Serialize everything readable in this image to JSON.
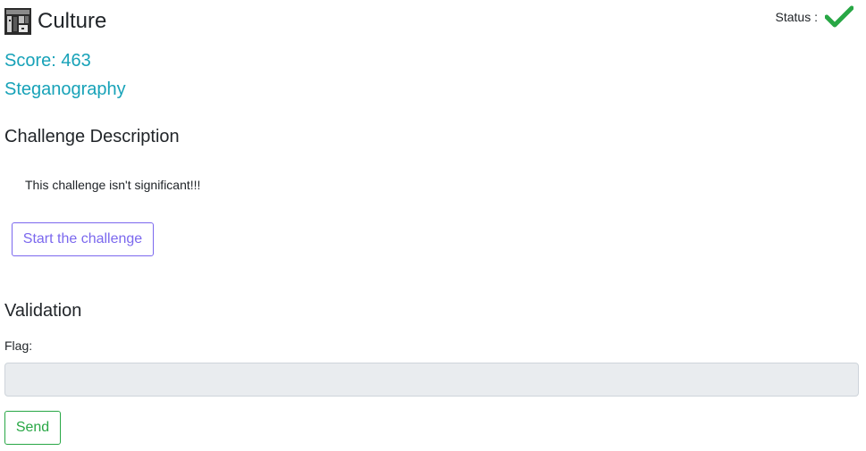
{
  "header": {
    "title": "Culture",
    "icon": "challenge-thumbnail-icon",
    "status_label": "Status :",
    "status_icon": "checkmark-icon",
    "status_color": "#28a745"
  },
  "info": {
    "score": "Score: 463",
    "category": "Steganography"
  },
  "description": {
    "heading": "Challenge Description",
    "text": "This challenge isn't significant!!!",
    "start_button_label": "Start the challenge"
  },
  "validation": {
    "heading": "Validation",
    "flag_label": "Flag:",
    "flag_value": "",
    "send_button_label": "Send"
  },
  "colors": {
    "accent_info": "#17a2b8",
    "start_button": "#7b68ee",
    "send_button": "#28a745"
  }
}
